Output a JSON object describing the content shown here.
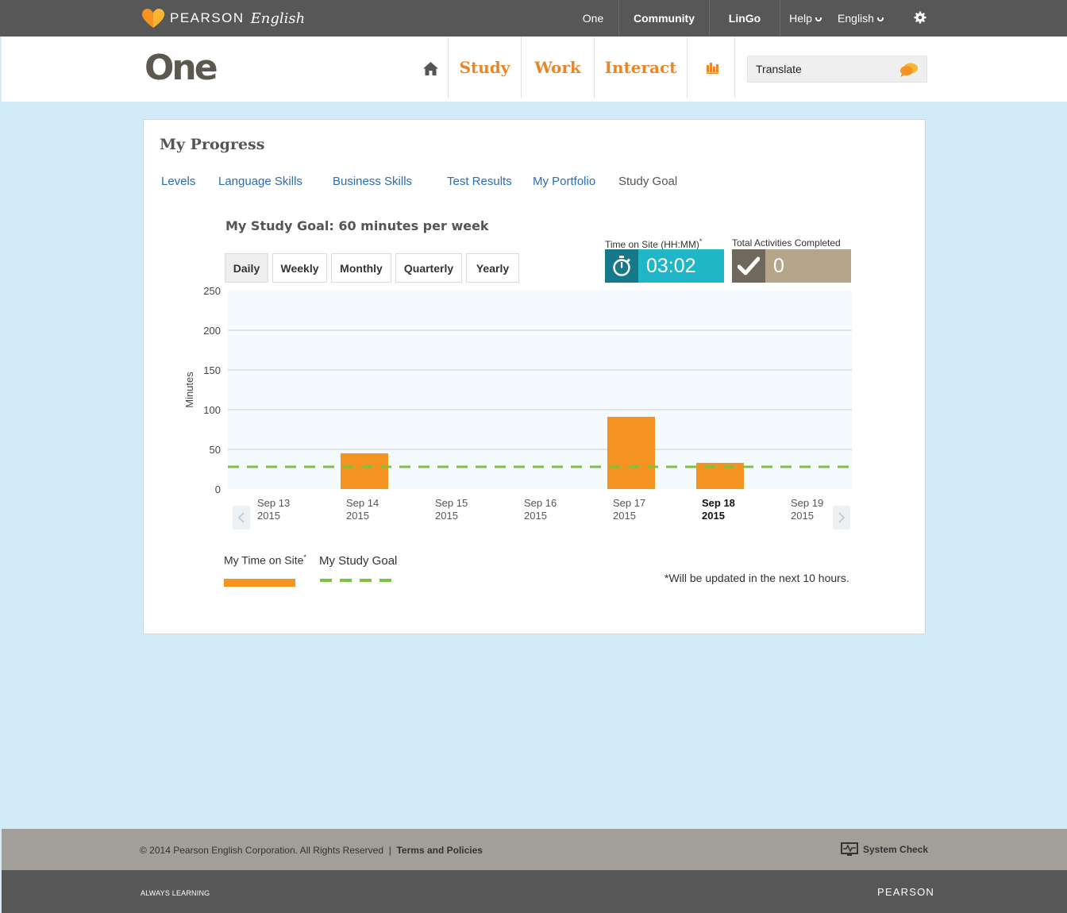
{
  "brand": {
    "word": "PEARSON",
    "script": "English",
    "heart_colors": [
      "#f59320",
      "#f7b733"
    ]
  },
  "topnav": {
    "items": [
      "One",
      "Community",
      "LinGo"
    ],
    "help": "Help",
    "language": "English",
    "gear": "gear-icon"
  },
  "header": {
    "logo": "One",
    "home": "home-icon",
    "nav": [
      "Study",
      "Work",
      "Interact"
    ],
    "stats": "bar-chart-icon",
    "translate_placeholder": "Translate",
    "translate_icon": "speech-bubble-icon"
  },
  "progress": {
    "title": "My Progress",
    "tabs": [
      "Levels",
      "Language Skills",
      "Business Skills",
      "Test Results",
      "My Portfolio",
      "Study Goal"
    ],
    "active_tab": "Study Goal",
    "goal_title": "My Study Goal: 60 minutes per week",
    "periods": [
      "Daily",
      "Weekly",
      "Monthly",
      "Quarterly",
      "Yearly"
    ],
    "active_period": "Daily",
    "time_on_site": {
      "label": "Time on Site (HH:MM)",
      "asterisk": "*",
      "value": "03:02",
      "color": "#1fb6c8",
      "icon_bg": "#16798a"
    },
    "activities": {
      "label": "Total Activities Completed",
      "value": "0",
      "color": "#b4a58b",
      "icon_bg": "#6f685c"
    },
    "legend": {
      "time": "My Time on Site",
      "asterisk": "*",
      "goal": "My Study Goal"
    },
    "footnote": "*Will be updated in the next 10 hours."
  },
  "chart_data": {
    "type": "bar",
    "ylabel": "Minutes",
    "ylim": [
      0,
      250
    ],
    "yticks": [
      0,
      50,
      100,
      150,
      200,
      250
    ],
    "categories": [
      [
        "Sep 13",
        "2015"
      ],
      [
        "Sep 14",
        "2015"
      ],
      [
        "Sep 15",
        "2015"
      ],
      [
        "Sep 16",
        "2015"
      ],
      [
        "Sep 17",
        "2015"
      ],
      [
        "Sep 18",
        "2015"
      ],
      [
        "Sep 19",
        "2015"
      ]
    ],
    "highlight_category": 5,
    "series": [
      {
        "name": "My Time on Site",
        "values": [
          0,
          45,
          0,
          0,
          91,
          33,
          0
        ],
        "color": "#f59320"
      }
    ],
    "goal_line": {
      "name": "My Study Goal",
      "value": 28,
      "color": "#7dc243"
    },
    "grid": true
  },
  "footer": {
    "copyright": "© 2014 Pearson English Corporation. All Rights Reserved",
    "divider": "|",
    "terms": "Terms and Policies",
    "system_check": "System Check",
    "system_check_icon": "monitor-pulse-icon",
    "tagline": "ALWAYS LEARNING",
    "pearson": "PEARSON"
  }
}
